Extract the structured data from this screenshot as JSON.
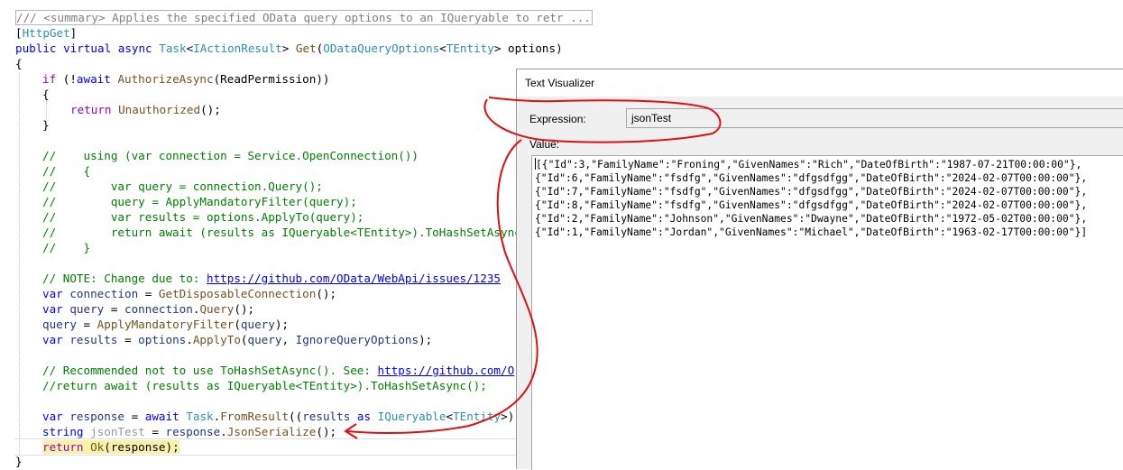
{
  "editor": {
    "summary_line": "/// <summary> Applies the specified OData query options to an IQueryable to retr ...",
    "attribute": {
      "open": "[",
      "name": "HttpGet",
      "close": "]"
    },
    "signature": {
      "mods": "public virtual async ",
      "task": "Task",
      "lt": "<",
      "iface": "IActionResult",
      "gt": "> ",
      "method": "Get",
      "paren": "(",
      "param_type": "ODataQueryOptions",
      "lt2": "<",
      "generic": "TEntity",
      "rest": "> options)"
    },
    "brace_open": "{",
    "if_line": {
      "kw": "if",
      "open": " (!",
      "await": "await",
      "sp": " ",
      "fn": "AuthorizeAsync",
      "rest": "(ReadPermission))"
    },
    "inner_open": "{",
    "return_line": {
      "kw": "return",
      "sp": " ",
      "fn": "Unauthorized",
      "rest": "();"
    },
    "inner_close": "}",
    "comment_lines": [
      "//    using (var connection = Service.OpenConnection())",
      "//    {",
      "//        var query = connection.Query();",
      "//        query = ApplyMandatoryFilter(query);",
      "//        var results = options.ApplyTo(query);",
      "//        return await (results as IQueryable<TEntity>).ToHashSetAsync();",
      "//    }"
    ],
    "note_line": {
      "text": "// NOTE: Change due to: ",
      "link": "https://github.com/OData/WebApi/issues/1235"
    },
    "conn_line": {
      "kw": "var",
      "sp": " ",
      "id": "connection",
      "eq": " = ",
      "fn": "GetDisposableConnection",
      "rest": "();"
    },
    "query_line": {
      "kw": "var",
      "sp": " ",
      "id": "query",
      "eq": " = ",
      "obj": "connection",
      "dot": ".",
      "fn": "Query",
      "rest": "();"
    },
    "filter_line": {
      "id": "query",
      "eq": " = ",
      "fn": "ApplyMandatoryFilter",
      "open": "(",
      "arg": "query",
      "rest": ");"
    },
    "results_line": {
      "kw": "var",
      "sp": " ",
      "id": "results",
      "eq": " = ",
      "obj": "options",
      "dot": ".",
      "fn": "ApplyTo",
      "open": "(",
      "arg1": "query",
      "comma": ", ",
      "arg2": "IgnoreQueryOptions",
      "rest": ");"
    },
    "recommend_line": {
      "text": "// Recommended not to use ToHashSetAsync(). See: ",
      "link": "https://github.com/O"
    },
    "return_comment": "//return await (results as IQueryable<TEntity>).ToHashSetAsync();",
    "response_line": {
      "kw": "var",
      "sp": " ",
      "id": "response",
      "eq": " = ",
      "await": "await",
      "sp2": " ",
      "type": "Task",
      "dot": ".",
      "fn": "FromResult",
      "open": "((",
      "arg": "results",
      "as": " as ",
      "iface": "IQueryable",
      "lt": "<",
      "generic": "TEntity",
      "rest": ">)"
    },
    "json_line": {
      "kw": "string",
      "sp": " ",
      "id": "jsonTest",
      "eq": " = ",
      "obj": "response",
      "dot": ".",
      "fn": "JsonSerialize",
      "rest": "();"
    },
    "ok_line": {
      "kw": "return",
      "sp": " ",
      "fn": "Ok",
      "rest": "(response);"
    },
    "brace_close": "}"
  },
  "visualizer": {
    "title": "Text Visualizer",
    "expression_label": "Expression:",
    "expression_value": "jsonTest",
    "value_label": "Value:",
    "value_lines": [
      "[{\"Id\":3,\"FamilyName\":\"Froning\",\"GivenNames\":\"Rich\",\"DateOfBirth\":\"1987-07-21T00:00:00\"},",
      "{\"Id\":6,\"FamilyName\":\"fsdfg\",\"GivenNames\":\"dfgsdfgg\",\"DateOfBirth\":\"2024-02-07T00:00:00\"},",
      "{\"Id\":7,\"FamilyName\":\"fsdfg\",\"GivenNames\":\"dfgsdfgg\",\"DateOfBirth\":\"2024-02-07T00:00:00\"},",
      "{\"Id\":8,\"FamilyName\":\"fsdfg\",\"GivenNames\":\"dfgsdfgg\",\"DateOfBirth\":\"2024-02-07T00:00:00\"},",
      "{\"Id\":2,\"FamilyName\":\"Johnson\",\"GivenNames\":\"Dwayne\",\"DateOfBirth\":\"1972-05-02T00:00:00\"},",
      "{\"Id\":1,\"FamilyName\":\"Jordan\",\"GivenNames\":\"Michael\",\"DateOfBirth\":\"1963-02-17T00:00:00\"}]"
    ]
  },
  "colors": {
    "keyword": "#0000ff",
    "type": "#2b91af",
    "method": "#74531f",
    "comment": "#008000",
    "annotation": "#e01010"
  }
}
